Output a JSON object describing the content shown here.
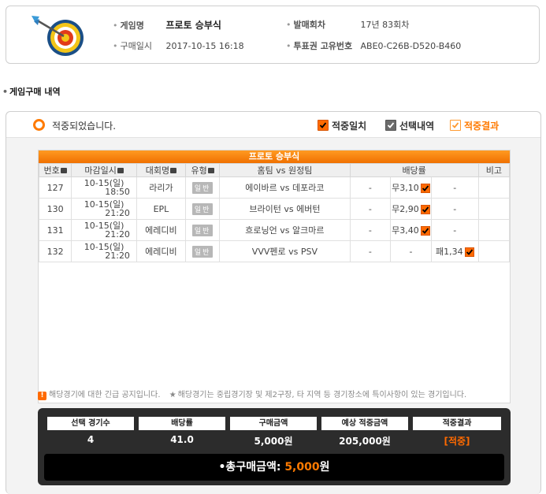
{
  "info": {
    "game_label": "게임명",
    "game_value": "프로토 승부식",
    "purchase_label": "구매일시",
    "purchase_value": "2017-10-15 16:18",
    "round_label": "발매회차",
    "round_value": "17년 83회차",
    "ticket_label": "투표권 고유번호",
    "ticket_value": "ABE0-C26B-D520-B460"
  },
  "section_title": "게임구매 내역",
  "panel": {
    "status_text": "적중되었습니다.",
    "legend": {
      "match": "적중일치",
      "selected": "선택내역",
      "result": "적중결과"
    },
    "colors": {
      "accent": "#ff7a00",
      "dark": "#2c2c2c"
    }
  },
  "table": {
    "title": "프로토 승부식",
    "headers": [
      "번호",
      "마감일시",
      "대회명",
      "유형",
      "홈팀 vs 원정팀",
      "배당률",
      "비고"
    ],
    "rows": [
      {
        "no": "127",
        "date": "10-15(일)",
        "time": "18:50",
        "league": "라리가",
        "type": "일반",
        "teams": "에이바르 vs 데포라코",
        "odd1": "-",
        "odd2": "무3,10",
        "odd3": "-"
      },
      {
        "no": "130",
        "date": "10-15(일)",
        "time": "21:20",
        "league": "EPL",
        "type": "일반",
        "teams": "브라이턴 vs 에버턴",
        "odd1": "-",
        "odd2": "무2,90",
        "odd3": "-"
      },
      {
        "no": "131",
        "date": "10-15(일)",
        "time": "21:20",
        "league": "에레디비",
        "type": "일반",
        "teams": "흐로닝언 vs 알크마르",
        "odd1": "-",
        "odd2": "무3,40",
        "odd3": "-"
      },
      {
        "no": "132",
        "date": "10-15(일)",
        "time": "21:20",
        "league": "에레디비",
        "type": "일반",
        "teams": "VVV펜로 vs PSV",
        "odd1": "-",
        "odd2": "-",
        "odd3": "패1,34"
      }
    ],
    "notice_1": "해당경기에 대한 긴급 공지입니다.",
    "notice_2": "해당경기는 중립경기장 및 제2구장, 타 지역 등 경기장소에 특이사항이 있는 경기입니다."
  },
  "summary": {
    "headers": [
      "선택 경기수",
      "배당률",
      "구매금액",
      "예상 적중금액",
      "적중결과"
    ],
    "values": [
      "4",
      "41.0",
      "5,000원",
      "205,000원",
      "[적중]"
    ],
    "total_label": "•총구매금액:",
    "total_amount": "5,000",
    "total_unit": "원"
  }
}
